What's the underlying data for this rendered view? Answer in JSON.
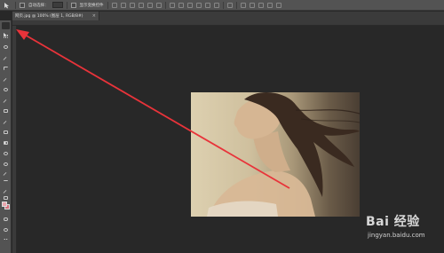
{
  "options_bar": {
    "auto_select_label": "自动选择：",
    "auto_select_value": "",
    "transform_controls_label": "显示变换控件"
  },
  "document": {
    "tab_title": "网页.jpg @ 100% (图层 1, RGB/8#)"
  },
  "toolbar": {
    "tools": [
      "move",
      "marquee",
      "lasso",
      "quick-select",
      "crop",
      "eyedropper",
      "healing",
      "brush",
      "clone-stamp",
      "history-brush",
      "eraser",
      "gradient",
      "blur",
      "dodge",
      "pen",
      "type",
      "path-select",
      "shape",
      "hand",
      "zoom",
      "more"
    ],
    "foreground_color": "#e8a6ad",
    "background_color": "#d66f7b"
  },
  "annotation": {
    "color": "#e8333a"
  },
  "watermark": {
    "logo": "Bai 经验",
    "url": "jingyan.baidu.com"
  }
}
